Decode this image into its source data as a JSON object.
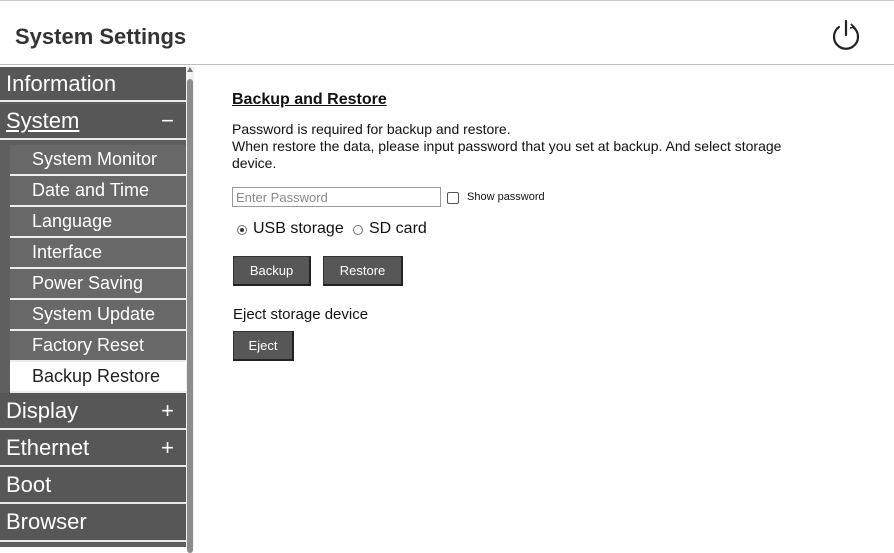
{
  "header": {
    "title": "System Settings",
    "power_icon": "power-icon"
  },
  "sidebar": {
    "menu": [
      {
        "label": "Information",
        "sign": ""
      },
      {
        "label": "System",
        "sign": "−"
      },
      {
        "label": "Display",
        "sign": "+"
      },
      {
        "label": "Ethernet",
        "sign": "+"
      },
      {
        "label": "Boot",
        "sign": ""
      },
      {
        "label": "Browser",
        "sign": ""
      }
    ],
    "system_items": [
      "System Monitor",
      "Date and Time",
      "Language",
      "Interface",
      "Power Saving",
      "System Update",
      "Factory Reset",
      "Backup Restore"
    ],
    "active_item": "Backup Restore"
  },
  "main": {
    "heading": "Backup and Restore",
    "desc_line1": "Password is required for backup and restore.",
    "desc_line2": "When restore the data, please input password that you set at backup. And select storage device.",
    "password_placeholder": "Enter Password",
    "show_password_label": "Show password",
    "storage_options": [
      "USB storage",
      "SD card"
    ],
    "storage_selected": "USB storage",
    "backup_label": "Backup",
    "restore_label": "Restore",
    "eject_title": "Eject storage device",
    "eject_label": "Eject"
  }
}
